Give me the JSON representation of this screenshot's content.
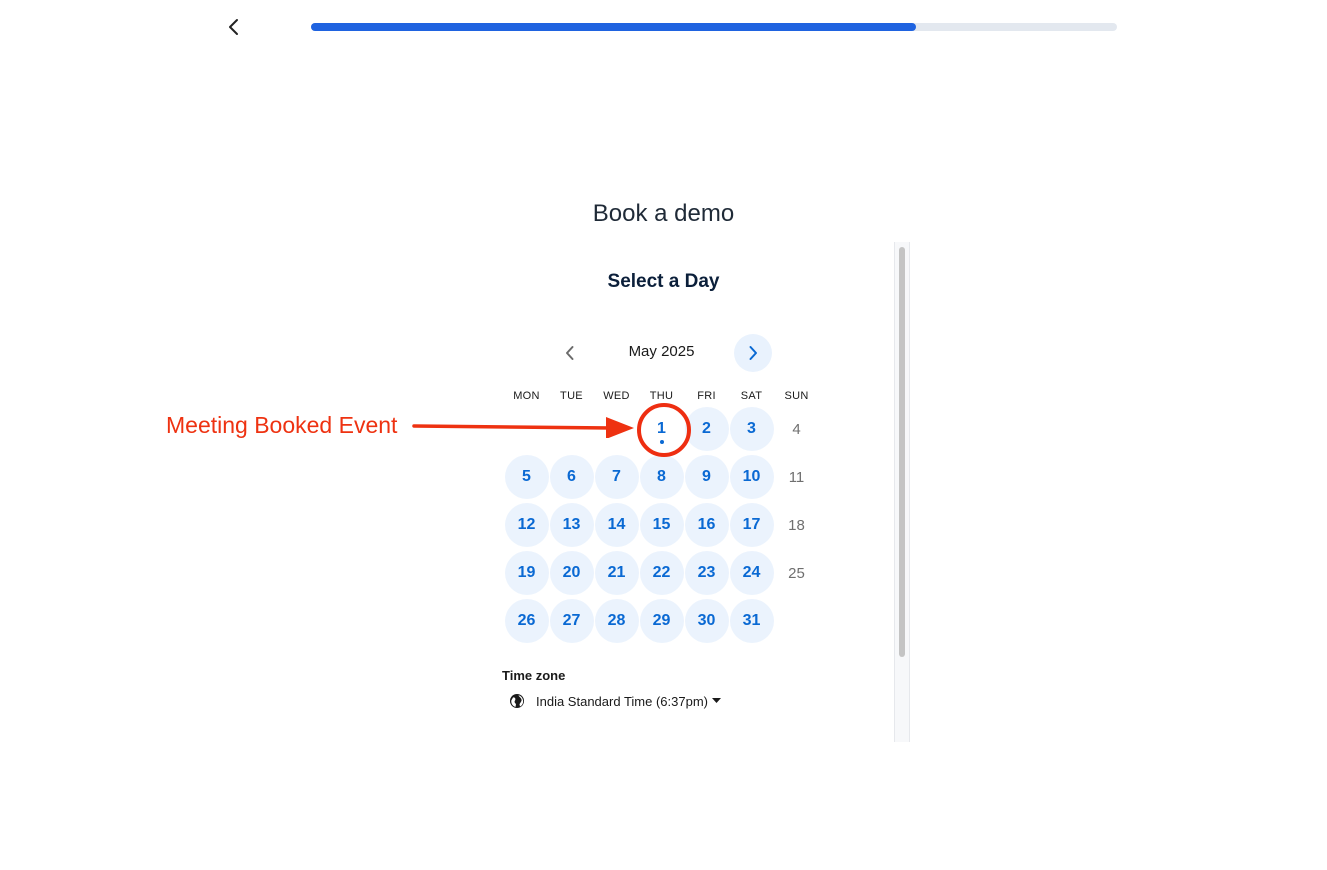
{
  "nav": {
    "back_icon": "chevron-left-icon",
    "progress_percent": 75
  },
  "page": {
    "title": "Book a demo"
  },
  "calendar": {
    "heading": "Select a Day",
    "month_label": "May 2025",
    "prev_icon": "chevron-left-icon",
    "next_icon": "chevron-right-icon",
    "weekdays": [
      "MON",
      "TUE",
      "WED",
      "THU",
      "FRI",
      "SAT",
      "SUN"
    ],
    "leading_blank_days": 3,
    "days": [
      {
        "label": "1",
        "available": true,
        "today": true
      },
      {
        "label": "2",
        "available": true
      },
      {
        "label": "3",
        "available": true
      },
      {
        "label": "4",
        "available": false
      },
      {
        "label": "5",
        "available": true
      },
      {
        "label": "6",
        "available": true
      },
      {
        "label": "7",
        "available": true
      },
      {
        "label": "8",
        "available": true
      },
      {
        "label": "9",
        "available": true
      },
      {
        "label": "10",
        "available": true
      },
      {
        "label": "11",
        "available": false
      },
      {
        "label": "12",
        "available": true
      },
      {
        "label": "13",
        "available": true
      },
      {
        "label": "14",
        "available": true
      },
      {
        "label": "15",
        "available": true
      },
      {
        "label": "16",
        "available": true
      },
      {
        "label": "17",
        "available": true
      },
      {
        "label": "18",
        "available": false
      },
      {
        "label": "19",
        "available": true
      },
      {
        "label": "20",
        "available": true
      },
      {
        "label": "21",
        "available": true
      },
      {
        "label": "22",
        "available": true
      },
      {
        "label": "23",
        "available": true
      },
      {
        "label": "24",
        "available": true
      },
      {
        "label": "25",
        "available": false
      },
      {
        "label": "26",
        "available": true
      },
      {
        "label": "27",
        "available": true
      },
      {
        "label": "28",
        "available": true
      },
      {
        "label": "29",
        "available": true
      },
      {
        "label": "30",
        "available": true
      },
      {
        "label": "31",
        "available": true
      }
    ]
  },
  "timezone": {
    "label": "Time zone",
    "value": "India Standard Time (6:37pm)",
    "icon": "globe-icon",
    "caret_icon": "caret-down-icon"
  },
  "annotation": {
    "text": "Meeting Booked Event",
    "color": "#ee3211"
  },
  "colors": {
    "accent": "#0a69d3",
    "progress": "#1f63e0",
    "available_bg": "#ebf3fd"
  }
}
